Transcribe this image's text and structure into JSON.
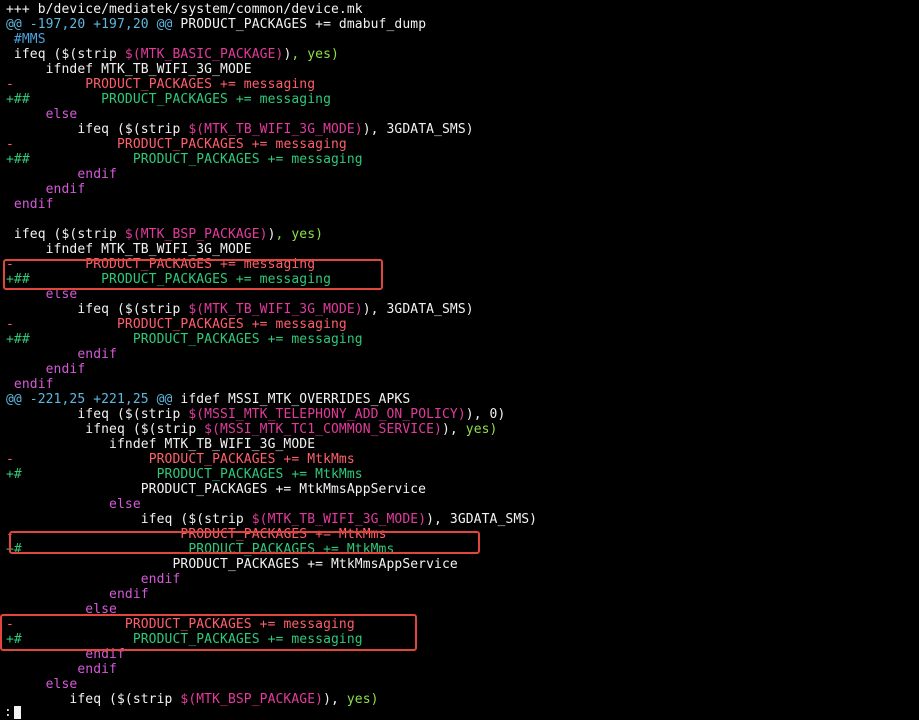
{
  "terminal": {
    "prompt_char": ":",
    "lines": [
      [
        [
          "+++ b/device/mediatek/system/common/device.mk",
          "white"
        ]
      ],
      [
        [
          "@@ -197,20 +197,20 @@",
          "cyan"
        ],
        [
          " PRODUCT_PACKAGES += dmabuf_dump",
          "white"
        ]
      ],
      [
        [
          " #MMS",
          "blue"
        ]
      ],
      [
        [
          " ifeq ($(strip ",
          "white"
        ],
        [
          "$(MTK_BASIC_PACKAGE)",
          "red-var"
        ],
        [
          ")",
          "white"
        ],
        [
          ", yes)",
          "lime"
        ]
      ],
      [
        [
          "     ifndef MTK_TB_WIFI_3G_MODE",
          "white"
        ]
      ],
      [
        [
          "-",
          "pink"
        ],
        [
          "         PRODUCT_PACKAGES += messaging",
          "pink"
        ]
      ],
      [
        [
          "+##",
          "green"
        ],
        [
          "         PRODUCT_PACKAGES += messaging",
          "green"
        ]
      ],
      [
        [
          "     else",
          "magenta"
        ]
      ],
      [
        [
          "         ifeq ($(strip ",
          "white"
        ],
        [
          "$(MTK_TB_WIFI_3G_MODE)",
          "red-var"
        ],
        [
          "), 3GDATA_SMS)",
          "white"
        ]
      ],
      [
        [
          "-",
          "pink"
        ],
        [
          "             PRODUCT_PACKAGES += messaging",
          "pink"
        ]
      ],
      [
        [
          "+##",
          "green"
        ],
        [
          "             PRODUCT_PACKAGES += messaging",
          "green"
        ]
      ],
      [
        [
          "         endif",
          "magenta"
        ]
      ],
      [
        [
          "     endif",
          "magenta"
        ]
      ],
      [
        [
          " endif",
          "magenta"
        ]
      ],
      [
        [
          "",
          "white"
        ]
      ],
      [
        [
          " ifeq ($(strip ",
          "white"
        ],
        [
          "$(MTK_BSP_PACKAGE)",
          "red-var"
        ],
        [
          ")",
          "white"
        ],
        [
          ", yes)",
          "lime"
        ]
      ],
      [
        [
          "     ifndef MTK_TB_WIFI_3G_MODE",
          "white"
        ]
      ],
      [
        [
          "-",
          "pink"
        ],
        [
          "         PRODUCT_PACKAGES += messaging",
          "pink"
        ]
      ],
      [
        [
          "+##",
          "green"
        ],
        [
          "         PRODUCT_PACKAGES += messaging",
          "green"
        ]
      ],
      [
        [
          "     else",
          "magenta"
        ]
      ],
      [
        [
          "         ifeq ($(strip ",
          "white"
        ],
        [
          "$(MTK_TB_WIFI_3G_MODE)",
          "red-var"
        ],
        [
          "), 3GDATA_SMS)",
          "white"
        ]
      ],
      [
        [
          "-",
          "pink"
        ],
        [
          "             PRODUCT_PACKAGES += messaging",
          "pink"
        ]
      ],
      [
        [
          "+##",
          "green"
        ],
        [
          "             PRODUCT_PACKAGES += messaging",
          "green"
        ]
      ],
      [
        [
          "         endif",
          "magenta"
        ]
      ],
      [
        [
          "     endif",
          "magenta"
        ]
      ],
      [
        [
          " endif",
          "magenta"
        ]
      ],
      [
        [
          "@@ -221,25 +221,25 @@",
          "cyan"
        ],
        [
          " ifdef MSSI_MTK_OVERRIDES_APKS",
          "white"
        ]
      ],
      [
        [
          "         ifeq ($(strip ",
          "white"
        ],
        [
          "$(MSSI_MTK_TELEPHONY_ADD_ON_POLICY)",
          "red-var"
        ],
        [
          "), 0)",
          "white"
        ]
      ],
      [
        [
          "          ifneq ($(strip ",
          "white"
        ],
        [
          "$(MSSI_MTK_TC1_COMMON_SERVICE)",
          "red-var"
        ],
        [
          "), ",
          "white"
        ],
        [
          "yes)",
          "lime"
        ]
      ],
      [
        [
          "             ifndef MTK_TB_WIFI_3G_MODE",
          "white"
        ]
      ],
      [
        [
          "-",
          "pink"
        ],
        [
          "                 PRODUCT_PACKAGES += MtkMms",
          "pink"
        ]
      ],
      [
        [
          "+#",
          "green"
        ],
        [
          "                 PRODUCT_PACKAGES += MtkMms",
          "green"
        ]
      ],
      [
        [
          "                 PRODUCT_PACKAGES += MtkMmsAppService",
          "white"
        ]
      ],
      [
        [
          "             else",
          "magenta"
        ]
      ],
      [
        [
          "                 ifeq ($(strip ",
          "white"
        ],
        [
          "$(MTK_TB_WIFI_3G_MODE)",
          "red-var"
        ],
        [
          "), 3GDATA_SMS)",
          "white"
        ]
      ],
      [
        [
          "-",
          "pink"
        ],
        [
          "                     PRODUCT_PACKAGES += MtkMms",
          "pink"
        ]
      ],
      [
        [
          "+#",
          "green"
        ],
        [
          "                     PRODUCT_PACKAGES += MtkMms",
          "green"
        ]
      ],
      [
        [
          "                     PRODUCT_PACKAGES += MtkMmsAppService",
          "white"
        ]
      ],
      [
        [
          "                 endif",
          "magenta"
        ]
      ],
      [
        [
          "             endif",
          "magenta"
        ]
      ],
      [
        [
          "          else",
          "magenta"
        ]
      ],
      [
        [
          "-",
          "pink"
        ],
        [
          "              PRODUCT_PACKAGES += messaging",
          "pink"
        ]
      ],
      [
        [
          "+#",
          "green"
        ],
        [
          "              PRODUCT_PACKAGES += messaging",
          "green"
        ]
      ],
      [
        [
          "          endif",
          "magenta"
        ]
      ],
      [
        [
          "         endif",
          "magenta"
        ]
      ],
      [
        [
          "     else",
          "magenta"
        ]
      ],
      [
        [
          "        ifeq ($(strip ",
          "white"
        ],
        [
          "$(MTK_BSP_PACKAGE)",
          "red-var"
        ],
        [
          "), ",
          "white"
        ],
        [
          "yes)",
          "lime"
        ]
      ]
    ]
  },
  "colors": {
    "background": "#000000",
    "highlight_box": "#e0463c",
    "added": "#2fc87a",
    "removed": "#ff5f6b",
    "hunk": "#5fb8e0",
    "keyword": "#d45bd8"
  }
}
